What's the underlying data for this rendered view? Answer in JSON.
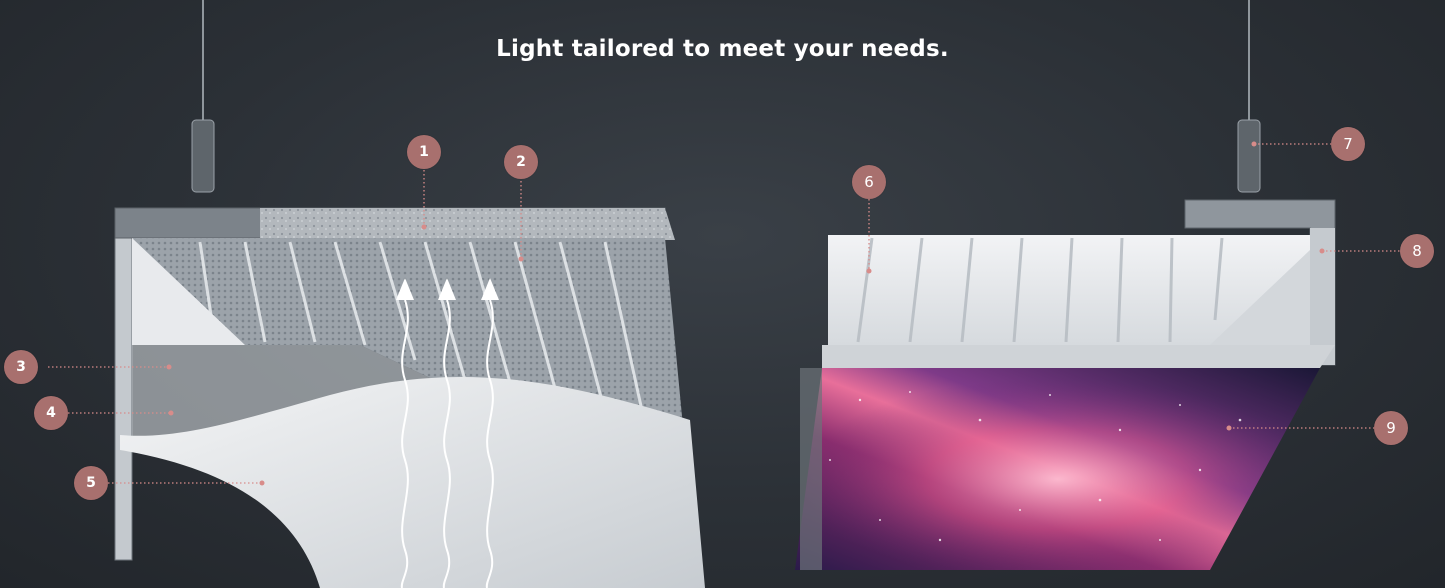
{
  "headline": "Light tailored to meet your needs.",
  "callouts": {
    "c1": "1",
    "c2": "2",
    "c3": "3",
    "c4": "4",
    "c5": "5",
    "c6": "6",
    "c7": "7",
    "c8": "8",
    "c9": "9"
  },
  "colors": {
    "background": "#2b3036",
    "callout": "#a8706e",
    "leader_line": "#d88c8a",
    "panel_white": "#eef0f2",
    "frame_gray": "#9aa1a8"
  }
}
